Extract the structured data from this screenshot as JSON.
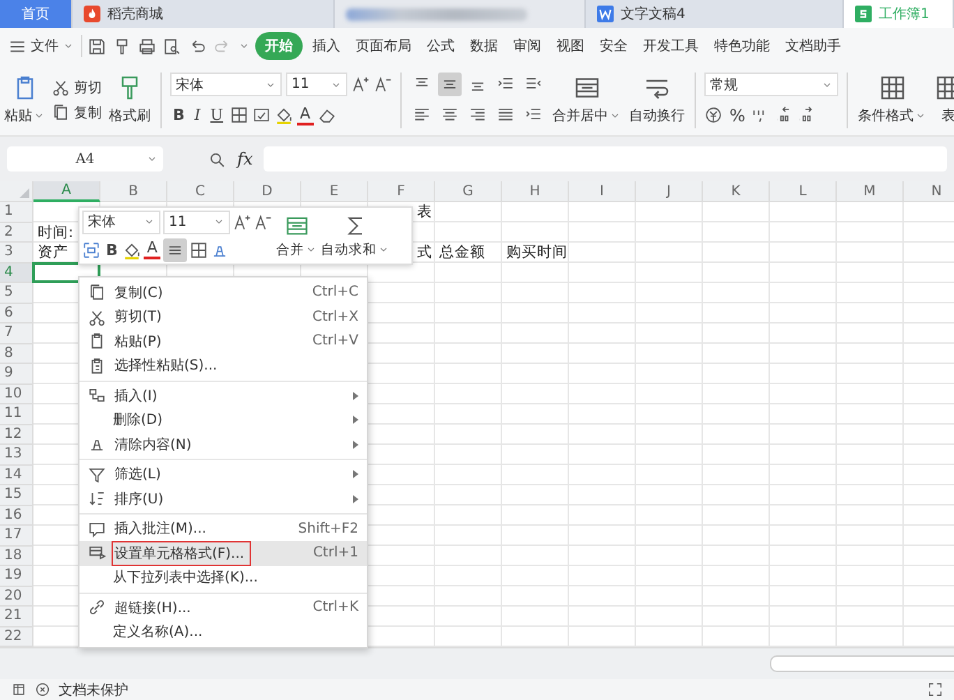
{
  "tabs": [
    {
      "kind": "home",
      "label": "首页",
      "selected": false
    },
    {
      "kind": "store",
      "label": "稻壳商城",
      "selected": false
    },
    {
      "kind": "blurred",
      "selected": false
    },
    {
      "kind": "doc",
      "label": "文字文稿4",
      "selected": false
    },
    {
      "kind": "sheet",
      "label": "工作簿1",
      "selected": true
    }
  ],
  "menu": {
    "file": "文件",
    "items": [
      {
        "label": "开始",
        "selected": true
      },
      {
        "label": "插入",
        "selected": false
      },
      {
        "label": "页面布局",
        "selected": false
      },
      {
        "label": "公式",
        "selected": false
      },
      {
        "label": "数据",
        "selected": false
      },
      {
        "label": "审阅",
        "selected": false
      },
      {
        "label": "视图",
        "selected": false
      },
      {
        "label": "安全",
        "selected": false
      },
      {
        "label": "开发工具",
        "selected": false
      },
      {
        "label": "特色功能",
        "selected": false
      },
      {
        "label": "文档助手",
        "selected": false
      }
    ]
  },
  "ribbon": {
    "paste": "粘贴",
    "cut": "剪切",
    "copy": "复制",
    "painter": "格式刷",
    "font": "宋体",
    "size": "11",
    "bold": "B",
    "italic": "I",
    "underline": "U",
    "font_color": "A",
    "merge": "合并居中",
    "wrap": "自动换行",
    "number_format": "常规",
    "percent": "%",
    "conditional": "条件格式",
    "table_style": "表",
    "align_buttons": [
      {
        "kind": "top",
        "selected": false
      },
      {
        "kind": "middle",
        "selected": true
      },
      {
        "kind": "bottom",
        "selected": false
      },
      {
        "kind": "outdent",
        "selected": false
      },
      {
        "kind": "indent",
        "selected": false
      }
    ]
  },
  "formula_bar": {
    "cell": "A4",
    "fx": "fx"
  },
  "grid": {
    "columns": [
      {
        "label": "A",
        "selected": true
      },
      {
        "label": "B",
        "selected": false
      },
      {
        "label": "C",
        "selected": false
      },
      {
        "label": "D",
        "selected": false
      },
      {
        "label": "E",
        "selected": false
      },
      {
        "label": "F",
        "selected": false
      },
      {
        "label": "G",
        "selected": false
      },
      {
        "label": "H",
        "selected": false
      },
      {
        "label": "I",
        "selected": false
      },
      {
        "label": "J",
        "selected": false
      },
      {
        "label": "K",
        "selected": false
      },
      {
        "label": "L",
        "selected": false
      },
      {
        "label": "M",
        "selected": false
      },
      {
        "label": "N",
        "selected": false
      }
    ],
    "rows": [
      {
        "number": "1",
        "selected": false,
        "cells": {
          "F": {
            "text": "表",
            "right_aligned": true
          }
        }
      },
      {
        "number": "2",
        "selected": false,
        "cells": {
          "A": {
            "text": "时间:",
            "right_aligned": false
          }
        }
      },
      {
        "number": "3",
        "selected": false,
        "cells": {
          "A": {
            "text": "资产",
            "right_aligned": false
          },
          "F": {
            "text": "式",
            "right_aligned": true
          },
          "G": {
            "text": "总金额",
            "right_aligned": false
          },
          "H": {
            "text": "购买时间",
            "right_aligned": false
          }
        }
      },
      {
        "number": "4",
        "selected": true
      },
      {
        "number": "5",
        "selected": false
      },
      {
        "number": "6",
        "selected": false
      },
      {
        "number": "7",
        "selected": false
      },
      {
        "number": "8",
        "selected": false
      },
      {
        "number": "9",
        "selected": false
      },
      {
        "number": "10",
        "selected": false
      },
      {
        "number": "11",
        "selected": false
      },
      {
        "number": "12",
        "selected": false
      },
      {
        "number": "13",
        "selected": false
      },
      {
        "number": "14",
        "selected": false
      },
      {
        "number": "15",
        "selected": false
      },
      {
        "number": "16",
        "selected": false
      },
      {
        "number": "17",
        "selected": false
      },
      {
        "number": "18",
        "selected": false
      },
      {
        "number": "19",
        "selected": false
      },
      {
        "number": "20",
        "selected": false
      },
      {
        "number": "21",
        "selected": false
      },
      {
        "number": "22",
        "selected": false
      }
    ]
  },
  "mini_toolbar": {
    "font": "宋体",
    "size": "11",
    "bold": "B",
    "font_color": "A",
    "center_selected": true,
    "merge": "合并",
    "autosum": "自动求和"
  },
  "context_menu": [
    {
      "kind": "copy",
      "label": "复制(C)",
      "shortcut": "Ctrl+C",
      "submenu": false,
      "highlighted": false
    },
    {
      "kind": "cut",
      "label": "剪切(T)",
      "shortcut": "Ctrl+X",
      "submenu": false,
      "highlighted": false
    },
    {
      "kind": "paste",
      "label": "粘贴(P)",
      "shortcut": "Ctrl+V",
      "submenu": false,
      "highlighted": false
    },
    {
      "kind": "pastespecial",
      "label": "选择性粘贴(S)...",
      "submenu": false,
      "highlighted": false
    },
    {
      "kind": "separator"
    },
    {
      "kind": "insert",
      "label": "插入(I)",
      "submenu": true,
      "highlighted": false
    },
    {
      "kind": "none",
      "label": "删除(D)",
      "submenu": true,
      "highlighted": false
    },
    {
      "kind": "clear",
      "label": "清除内容(N)",
      "submenu": true,
      "highlighted": false
    },
    {
      "kind": "separator"
    },
    {
      "kind": "filter",
      "label": "筛选(L)",
      "submenu": true,
      "highlighted": false
    },
    {
      "kind": "sort",
      "label": "排序(U)",
      "submenu": true,
      "highlighted": false
    },
    {
      "kind": "separator"
    },
    {
      "kind": "comment",
      "label": "插入批注(M)...",
      "shortcut": "Shift+F2",
      "submenu": false,
      "highlighted": false
    },
    {
      "kind": "format",
      "label": "设置单元格格式(F)...",
      "shortcut": "Ctrl+1",
      "submenu": false,
      "highlighted": true
    },
    {
      "kind": "none",
      "label": "从下拉列表中选择(K)...",
      "submenu": false,
      "highlighted": false
    },
    {
      "kind": "separator"
    },
    {
      "kind": "link",
      "label": "超链接(H)...",
      "shortcut": "Ctrl+K",
      "submenu": false,
      "highlighted": false
    },
    {
      "kind": "none",
      "label": "定义名称(A)...",
      "submenu": false,
      "highlighted": false
    }
  ],
  "status_bar": {
    "protection": "文档未保护"
  }
}
